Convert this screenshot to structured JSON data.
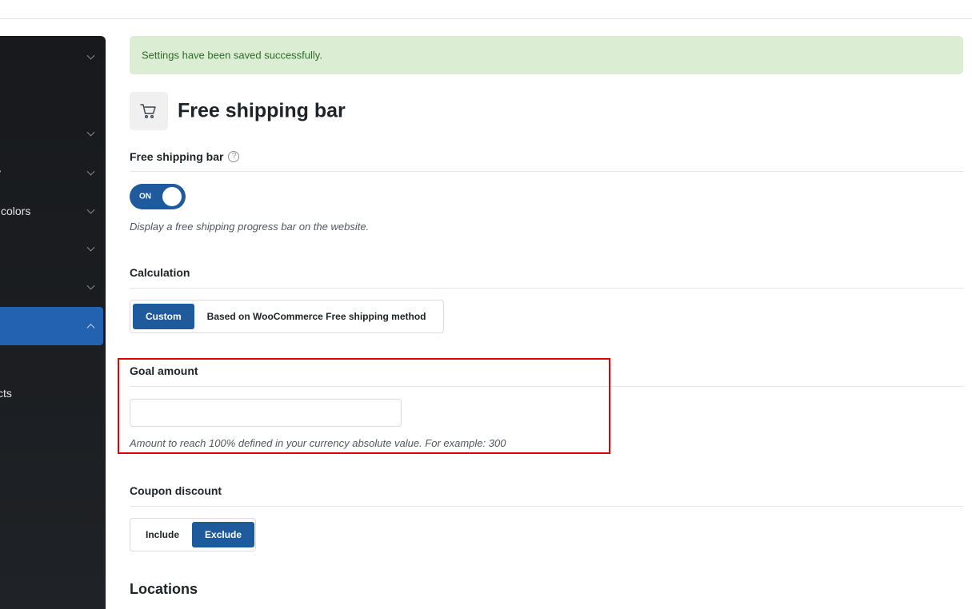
{
  "sidebar": {
    "items": [
      {
        "label": "",
        "active": false,
        "expanded": false
      },
      {
        "label": "",
        "active": false,
        "expanded": false
      },
      {
        "label": "y",
        "active": false,
        "expanded": false
      },
      {
        "label": "colors",
        "active": false,
        "expanded": false
      },
      {
        "label": "",
        "active": false,
        "expanded": false
      },
      {
        "label": "",
        "active": false,
        "expanded": false
      },
      {
        "label": "",
        "active": true,
        "expanded": true
      },
      {
        "label": "cts",
        "active": false,
        "expanded": false
      }
    ],
    "accent_color": "#2362b1"
  },
  "notice": {
    "text": "Settings have been saved successfully."
  },
  "page": {
    "title": "Free shipping bar",
    "icon": "cart-icon"
  },
  "free_shipping": {
    "heading": "Free shipping bar",
    "help_icon": "?",
    "toggle_label": "ON",
    "toggle_on": true,
    "help": "Display a free shipping progress bar on the website."
  },
  "calculation": {
    "heading": "Calculation",
    "options": [
      "Custom",
      "Based on WooCommerce Free shipping method"
    ],
    "selected": "Custom"
  },
  "goal": {
    "heading": "Goal amount",
    "value": "",
    "help": "Amount to reach 100% defined in your currency absolute value. For example: 300"
  },
  "coupon": {
    "heading": "Coupon discount",
    "options": [
      "Include",
      "Exclude"
    ],
    "selected": "Exclude"
  },
  "locations": {
    "heading": "Locations"
  },
  "colors": {
    "primary": "#1e5a9c",
    "notice_bg": "#dbeed3",
    "notice_text": "#2f6b2a",
    "highlight": "#e00000"
  }
}
